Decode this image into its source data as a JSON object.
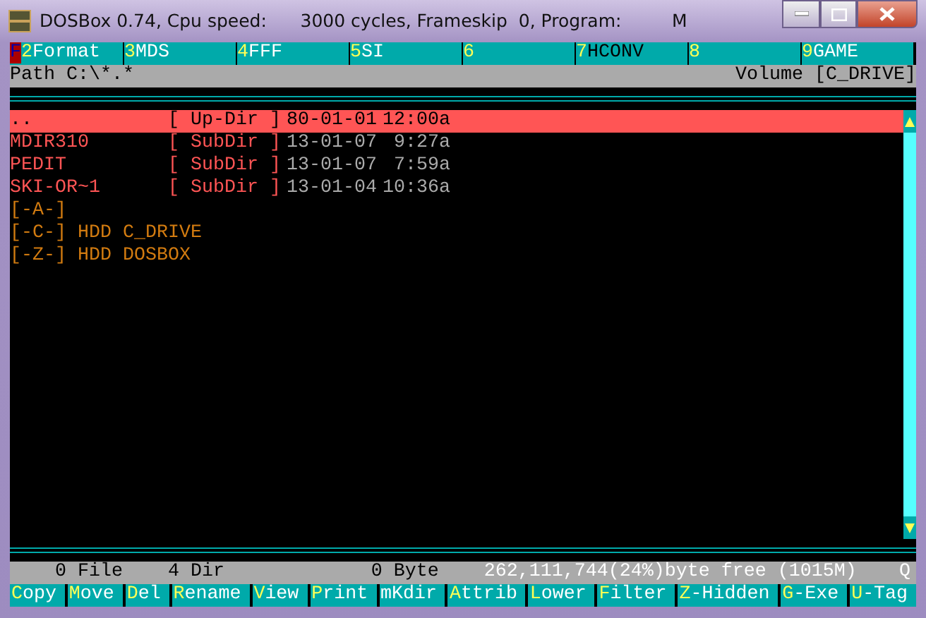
{
  "window": {
    "title": "DOSBox 0.74, Cpu speed:      3000 cycles, Frameskip  0, Program:         M"
  },
  "function_keys": {
    "cursor": "F",
    "keys": [
      {
        "key": "2",
        "label": "Format",
        "kind": "normal"
      },
      {
        "key": "3",
        "label": "MDS",
        "kind": "normal"
      },
      {
        "key": "4",
        "label": "FFF",
        "kind": "normal"
      },
      {
        "key": "5",
        "label": "SI",
        "kind": "normal"
      },
      {
        "key": "6"
      },
      {
        "key": "7",
        "label": "HCONV",
        "kind": "dark"
      },
      {
        "key": "8"
      },
      {
        "key": "9",
        "label": "GAME",
        "kind": "normal"
      }
    ]
  },
  "path_bar": {
    "path": "Path C:\\*.*",
    "volume": "Volume [C_DRIVE]"
  },
  "files": [
    {
      "kind": "updir",
      "name": "..",
      "type": "[ Up-Dir ]",
      "date": "80-01-01",
      "time": "12:00a",
      "selected": true
    },
    {
      "kind": "dir",
      "name": "MDIR310",
      "type": "[ SubDir ]",
      "date": "13-01-07",
      "time": " 9:27a",
      "selected": false
    },
    {
      "kind": "dir",
      "name": "PEDIT",
      "type": "[ SubDir ]",
      "date": "13-01-07",
      "time": " 7:59a",
      "selected": false
    },
    {
      "kind": "dir",
      "name": "SKI-OR~1",
      "type": "[ SubDir ]",
      "date": "13-01-04",
      "time": "10:36a",
      "selected": false
    },
    {
      "kind": "drive",
      "name": "[-A-]",
      "selected": false
    },
    {
      "kind": "drive",
      "name": "[-C-] HDD C_DRIVE",
      "selected": false
    },
    {
      "kind": "drive",
      "name": "[-Z-] HDD DOSBOX",
      "selected": false
    }
  ],
  "status_bar": {
    "files": "0 File",
    "dirs": "4 Dir",
    "bytes": "0 Byte",
    "free": "262,111,744(24%)byte free (1015M)",
    "mode": "Q"
  },
  "commands": [
    {
      "hot": "C",
      "text": "opy"
    },
    {
      "hot": "M",
      "text": "ove"
    },
    {
      "hot": "D",
      "text": "el"
    },
    {
      "hot": "R",
      "text": "ename"
    },
    {
      "hot": "V",
      "text": "iew"
    },
    {
      "hot": "P",
      "text": "rint"
    },
    {
      "text": "mKdir"
    },
    {
      "hot": "A",
      "text": "ttrib"
    },
    {
      "hot": "L",
      "text": "ower"
    },
    {
      "hot": "F",
      "text": "ilter"
    },
    {
      "hot": "Z",
      "text": "-Hidden"
    },
    {
      "hot": "G",
      "text": "-Exe"
    },
    {
      "hot": "U",
      "text": "-Tag"
    }
  ]
}
